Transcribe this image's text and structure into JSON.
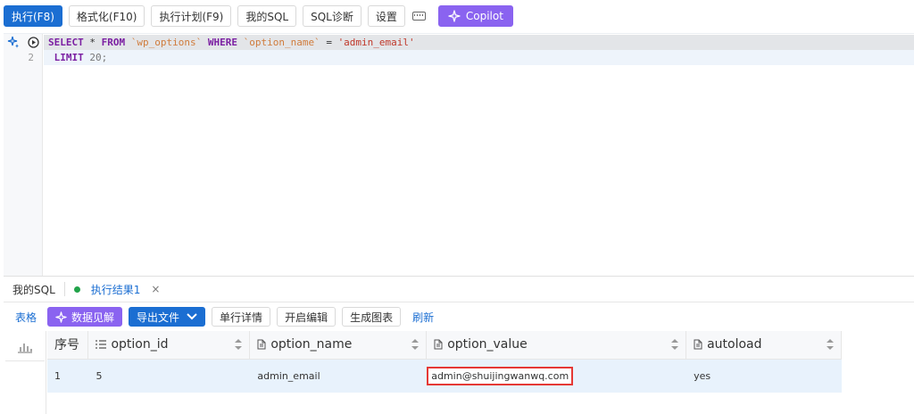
{
  "toolbar": {
    "run": "执行(F8)",
    "format": "格式化(F10)",
    "plan": "执行计划(F9)",
    "my_sql": "我的SQL",
    "diagnose": "SQL诊断",
    "settings": "设置",
    "keyboard_icon": "keyboard-icon",
    "copilot": "Copilot"
  },
  "editor": {
    "line_numbers": [
      "2"
    ],
    "line1": {
      "select": "SELECT",
      "star": " * ",
      "from": "FROM",
      "table": " `wp_options` ",
      "where": "WHERE",
      "column": " `option_name` ",
      "eq": "= ",
      "value": "'admin_email'"
    },
    "line2": {
      "limit": " LIMIT",
      "count": " 20;"
    }
  },
  "bottom_tabs": {
    "my_sql": "我的SQL",
    "result": "执行结果1",
    "close": "×"
  },
  "results_toolbar": {
    "table_view": "表格",
    "insights": "数据见解",
    "export": "导出文件",
    "row_detail": "单行详情",
    "edit": "开启编辑",
    "chart": "生成图表",
    "refresh": "刷新"
  },
  "table": {
    "headers": [
      "序号",
      "option_id",
      "option_name",
      "option_value",
      "autoload"
    ],
    "rows": [
      [
        "1",
        "5",
        "admin_email",
        "admin@shuijingwanwq.com",
        "yes"
      ]
    ]
  },
  "colors": {
    "primary": "#1b6ed2",
    "copilot": "#8a63f0",
    "highlight_border": "#e53935",
    "selected_row": "#e8f2fc"
  }
}
